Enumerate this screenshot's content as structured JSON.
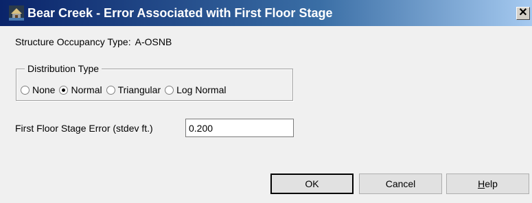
{
  "window": {
    "title": "Bear Creek - Error Associated with First Floor Stage",
    "close_label": "✕"
  },
  "occupancy": {
    "label": "Structure Occupancy Type:",
    "value": "A-OSNB"
  },
  "distribution": {
    "group_label": "Distribution Type",
    "options": [
      {
        "label": "None",
        "checked": false
      },
      {
        "label": "Normal",
        "checked": true
      },
      {
        "label": "Triangular",
        "checked": false
      },
      {
        "label": "Log Normal",
        "checked": false
      }
    ]
  },
  "error_field": {
    "label": "First Floor Stage Error (stdev ft.)",
    "value": "0.200"
  },
  "buttons": {
    "ok": "OK",
    "cancel": "Cancel",
    "help_underlined": "H",
    "help_rest": "elp"
  }
}
